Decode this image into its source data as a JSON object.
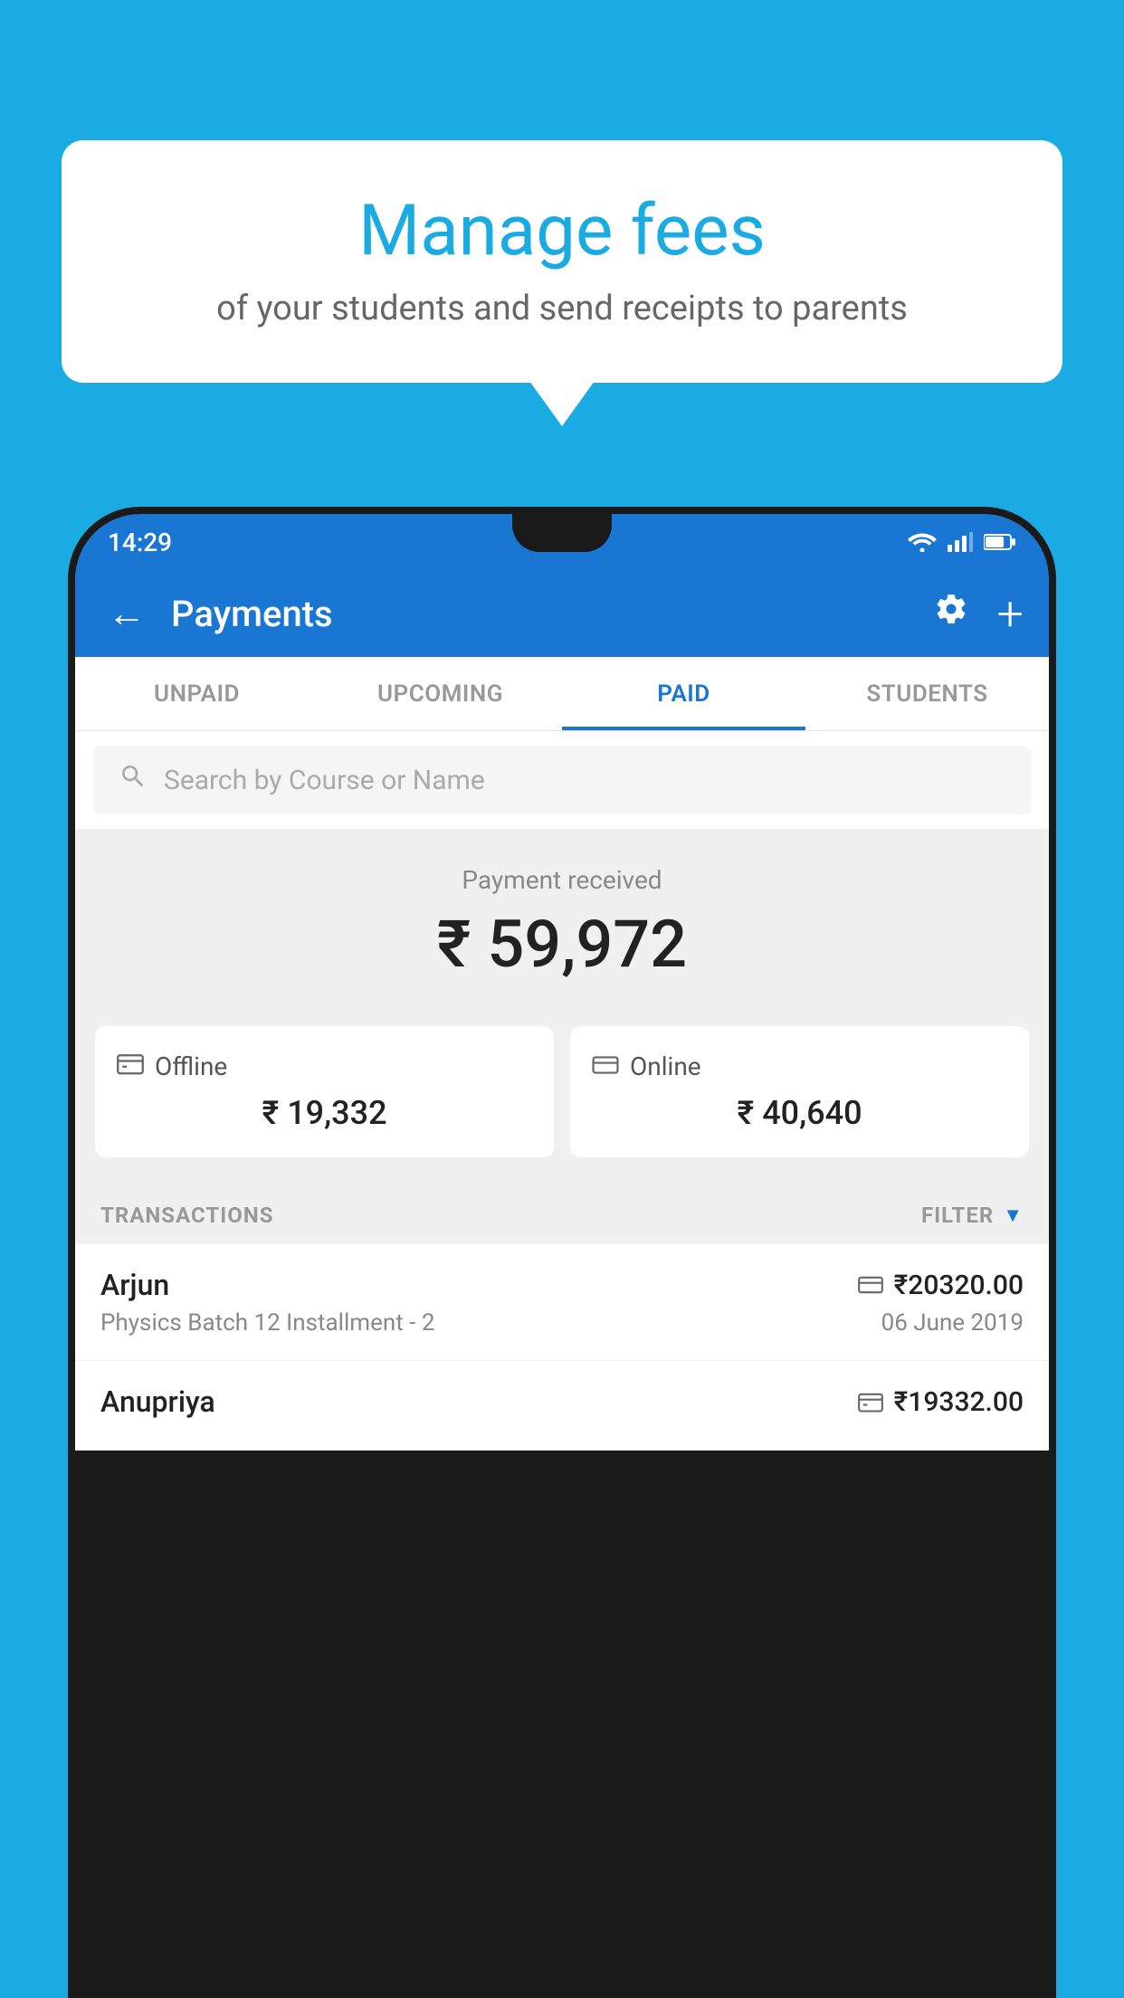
{
  "background_color": "#1AABE3",
  "speech_bubble": {
    "title": "Manage fees",
    "subtitle": "of your students and send receipts to parents"
  },
  "status_bar": {
    "time": "14:29"
  },
  "top_bar": {
    "title": "Payments",
    "back_label": "←",
    "settings_label": "⚙",
    "add_label": "+"
  },
  "tabs": [
    {
      "id": "unpaid",
      "label": "UNPAID",
      "active": false
    },
    {
      "id": "upcoming",
      "label": "UPCOMING",
      "active": false
    },
    {
      "id": "paid",
      "label": "PAID",
      "active": true
    },
    {
      "id": "students",
      "label": "STUDENTS",
      "active": false
    }
  ],
  "search": {
    "placeholder": "Search by Course or Name"
  },
  "payment": {
    "label": "Payment received",
    "total": "₹ 59,972",
    "offline_label": "Offline",
    "offline_amount": "₹ 19,332",
    "online_label": "Online",
    "online_amount": "₹ 40,640"
  },
  "transactions": {
    "section_label": "TRANSACTIONS",
    "filter_label": "FILTER",
    "items": [
      {
        "name": "Arjun",
        "amount": "₹20320.00",
        "course": "Physics Batch 12 Installment - 2",
        "date": "06 June 2019",
        "payment_type": "online"
      },
      {
        "name": "Anupriya",
        "amount": "₹19332.00",
        "course": "",
        "date": "",
        "payment_type": "offline"
      }
    ]
  }
}
